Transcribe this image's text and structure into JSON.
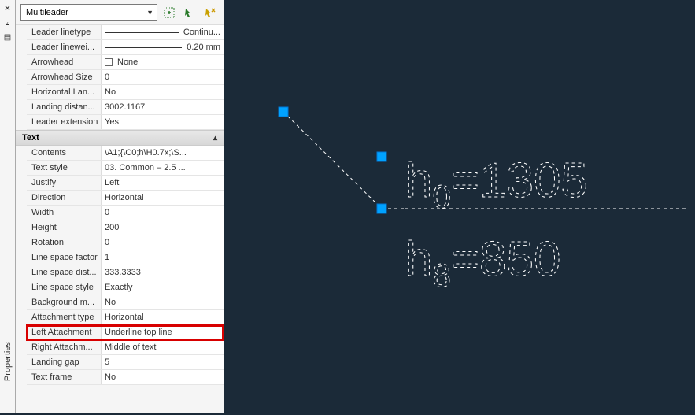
{
  "panel": {
    "title": "Properties",
    "object_type": "Multileader"
  },
  "rows_upper": [
    {
      "label": "Leader linetype",
      "value": "Continu...",
      "icon": "line"
    },
    {
      "label": "Leader linewei...",
      "value": "0.20 mm",
      "icon": "line"
    },
    {
      "label": "Arrowhead",
      "value": "None",
      "icon": "swatch"
    },
    {
      "label": "Arrowhead Size",
      "value": "0"
    },
    {
      "label": "Horizontal Lan...",
      "value": "No"
    },
    {
      "label": "Landing distan...",
      "value": "3002.1167"
    },
    {
      "label": "Leader extension",
      "value": "Yes"
    }
  ],
  "section": {
    "label": "Text"
  },
  "rows_text": [
    {
      "label": "Contents",
      "value": "\\A1;{\\C0;h\\H0.7x;\\S..."
    },
    {
      "label": "Text style",
      "value": "03. Common – 2.5 ..."
    },
    {
      "label": "Justify",
      "value": "Left"
    },
    {
      "label": "Direction",
      "value": "Horizontal"
    },
    {
      "label": "Width",
      "value": "0"
    },
    {
      "label": "Height",
      "value": "200"
    },
    {
      "label": "Rotation",
      "value": "0"
    },
    {
      "label": "Line space factor",
      "value": "1"
    },
    {
      "label": "Line space dist...",
      "value": "333.3333"
    },
    {
      "label": "Line space style",
      "value": "Exactly"
    },
    {
      "label": "Background m...",
      "value": "No"
    },
    {
      "label": "Attachment type",
      "value": "Horizontal"
    },
    {
      "label": "Left Attachment",
      "value": "Underline top line",
      "highlight": true
    },
    {
      "label": "Right Attachm...",
      "value": "Middle of text"
    },
    {
      "label": "Landing gap",
      "value": "5"
    },
    {
      "label": "Text frame",
      "value": "No"
    }
  ],
  "canvas": {
    "text_line1": "h0=1305",
    "text_line2": "h8=850"
  }
}
